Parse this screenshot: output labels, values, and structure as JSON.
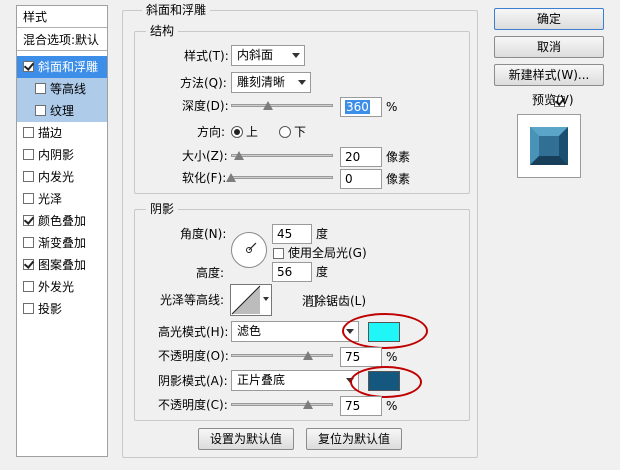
{
  "colors": {
    "highlight_swatch": "#20f6f8",
    "shadow_swatch": "#14587f",
    "selection": "#3d8ee8",
    "annotation": "#c00000"
  },
  "style_list": {
    "header": "样式",
    "blend": "混合选项:默认",
    "items": [
      {
        "label": "斜面和浮雕",
        "checked": true
      },
      {
        "label": "等高线",
        "checked": false
      },
      {
        "label": "纹理",
        "checked": false
      },
      {
        "label": "描边",
        "checked": false
      },
      {
        "label": "内阴影",
        "checked": false
      },
      {
        "label": "内发光",
        "checked": false
      },
      {
        "label": "光泽",
        "checked": false
      },
      {
        "label": "颜色叠加",
        "checked": true
      },
      {
        "label": "渐变叠加",
        "checked": false
      },
      {
        "label": "图案叠加",
        "checked": true
      },
      {
        "label": "外发光",
        "checked": false
      },
      {
        "label": "投影",
        "checked": false
      }
    ]
  },
  "bevel": {
    "title": "斜面和浮雕",
    "structure": {
      "title": "结构",
      "style_label": "样式(T):",
      "style_value": "内斜面",
      "method_label": "方法(Q):",
      "method_value": "雕刻清晰",
      "depth_label": "深度(D):",
      "depth_value": "360",
      "depth_unit": "%",
      "depth_pct": 0.36,
      "direction_label": "方向:",
      "dir_up": "上",
      "dir_down": "下",
      "size_label": "大小(Z):",
      "size_value": "20",
      "size_unit": "像素",
      "size_pct": 0.08,
      "soften_label": "软化(F):",
      "soften_value": "0",
      "soften_unit": "像素",
      "soften_pct": 0.0
    },
    "shading": {
      "title": "阴影",
      "angle_label": "角度(N):",
      "angle_value": "45",
      "angle_unit": "度",
      "global_light": "使用全局光(G)",
      "altitude_label": "高度:",
      "altitude_value": "56",
      "altitude_unit": "度",
      "gloss_label": "光泽等高线:",
      "antialias": "消除锯齿(L)",
      "highlight_label": "高光模式(H):",
      "highlight_value": "滤色",
      "h_opacity_label": "不透明度(O):",
      "h_opacity_value": "75",
      "h_opacity_unit": "%",
      "h_opacity_pct": 0.75,
      "shadow_label": "阴影模式(A):",
      "shadow_value": "正片叠底",
      "s_opacity_label": "不透明度(C):",
      "s_opacity_value": "75",
      "s_opacity_unit": "%",
      "s_opacity_pct": 0.75
    },
    "set_default": "设置为默认值",
    "reset_default": "复位为默认值"
  },
  "buttons": {
    "ok": "确定",
    "cancel": "取消",
    "new_style": "新建样式(W)...",
    "preview": "预览(V)"
  }
}
